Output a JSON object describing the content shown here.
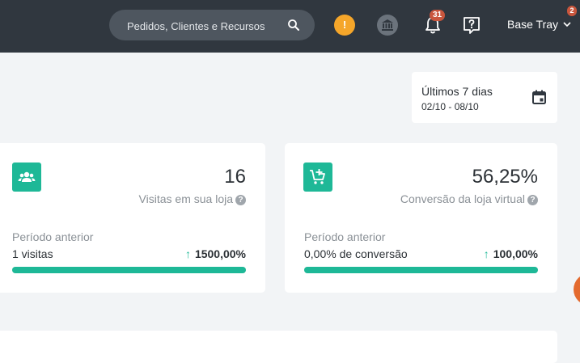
{
  "header": {
    "search": {
      "placeholder": "Pedidos, Clientes e Recursos"
    },
    "alert_symbol": "!",
    "notifications_count": "31",
    "account": {
      "name": "Base Tray",
      "badge": "2"
    }
  },
  "date_filter": {
    "label": "Últimos 7 dias",
    "range": "02/10 - 08/10"
  },
  "cards": [
    {
      "icon": "users-icon",
      "value": "16",
      "label": "Visitas em sua loja",
      "help": "?",
      "previous_label": "Período anterior",
      "previous_value": "1 visitas",
      "change_arrow": "↑",
      "change": "1500,00%",
      "progress_fraction": 1.0
    },
    {
      "icon": "cart-plus-icon",
      "value": "56,25%",
      "label": "Conversão da loja virtual",
      "help": "?",
      "previous_label": "Período anterior",
      "previous_value": "0,00% de conversão",
      "change_arrow": "↑",
      "change": "100,00%",
      "progress_fraction": 1.0
    }
  ],
  "colors": {
    "topbar": "#30373f",
    "accent": "#1eb897",
    "alert": "#f5a62a",
    "badge": "#c9563d"
  }
}
